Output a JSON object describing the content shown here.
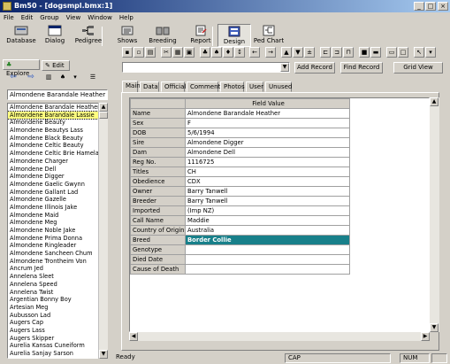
{
  "window": {
    "title": "Bm50 - [dogsmpl.bmx:1]",
    "min": "_",
    "max": "□",
    "close": "×"
  },
  "menu": [
    "File",
    "Edit",
    "Group",
    "View",
    "Window",
    "Help"
  ],
  "toolbar": [
    {
      "label": "Database",
      "icon": "database-icon"
    },
    {
      "label": "Dialog",
      "icon": "dialog-icon"
    },
    {
      "label": "Pedigree",
      "icon": "pedigree-icon"
    },
    {
      "label": "Shows",
      "icon": "shows-icon"
    },
    {
      "label": "Breeding",
      "icon": "breeding-icon"
    },
    {
      "label": "Report",
      "icon": "report-icon"
    },
    {
      "label": "Design",
      "icon": "design-icon"
    },
    {
      "label": "Ped Chart",
      "icon": "pedchart-icon"
    }
  ],
  "actions": {
    "add_record": "Add Record",
    "find_record": "Find Record",
    "grid_view": "Grid View"
  },
  "left_tabs": {
    "explore": "Explore",
    "edit": "Edit"
  },
  "search_value": "Almondene Barandale Heather",
  "dogs": [
    "Almondene Barandale Heather",
    "Almondene Barandale Lassie",
    "Almondene Beauty",
    "Almondene Beautys Lass",
    "Almondene Black Beauty",
    "Almondene Celtic Beauty",
    "Almondene Celtic Brie Hameland T",
    "Almondene Charger",
    "Almondene Dell",
    "Almondene Digger",
    "Almondene Gaelic Gwynn",
    "Almondene Gallant Lad",
    "Almondene Gazelle",
    "Almondene Illinois Jake",
    "Almondene Maid",
    "Almondene Meg",
    "Almondene Noble Jake",
    "Almondene Prima Donna",
    "Almondene Ringleader",
    "Almondene Sancheen Chum",
    "Almondene Trontheim Von",
    "Ancrum Jed",
    "Annelena Sleet",
    "Annelena Speed",
    "Annelena Twist",
    "Argentian Bonny Boy",
    "Artesian Meg",
    "Aubusson Lad",
    "Augers Cap",
    "Augers Lass",
    "Augers Skipper",
    "Aurelia Kansas Cuneiform",
    "Aurelia Sanjay Sarson"
  ],
  "selected_dog_index": 1,
  "tabs": [
    "Main",
    "Data",
    "Official",
    "Comments",
    "Photos",
    "User",
    "Unused"
  ],
  "grid_header": "Field Value",
  "fields": [
    {
      "name": "Name",
      "value": "Almondene Barandale Heather"
    },
    {
      "name": "Sex",
      "value": "F"
    },
    {
      "name": "DOB",
      "value": "5/6/1994"
    },
    {
      "name": "Sire",
      "value": "Almondene Digger"
    },
    {
      "name": "Dam",
      "value": "Almondene Dell"
    },
    {
      "name": "Reg No.",
      "value": "1116725"
    },
    {
      "name": "Titles",
      "value": "CH"
    },
    {
      "name": "Obedience",
      "value": "CDX"
    },
    {
      "name": "Owner",
      "value": "Barry Tanwell"
    },
    {
      "name": "Breeder",
      "value": "Barry Tanwell"
    },
    {
      "name": "Imported",
      "value": "(Imp NZ)"
    },
    {
      "name": "Call Name",
      "value": "Maddie"
    },
    {
      "name": "Country of Origin",
      "value": "Australia"
    },
    {
      "name": "Breed",
      "value": "Border Collie"
    },
    {
      "name": "Genotype",
      "value": ""
    },
    {
      "name": "Died Date",
      "value": ""
    },
    {
      "name": "Cause of Death",
      "value": ""
    }
  ],
  "highlight_field": "Breed",
  "status": {
    "ready": "Ready",
    "cap": "CAP",
    "num": "NUM"
  },
  "colors": {
    "title_start": "#0a246a",
    "title_end": "#a6caf0",
    "selection": "#ffff80",
    "highlight": "#18808a"
  }
}
